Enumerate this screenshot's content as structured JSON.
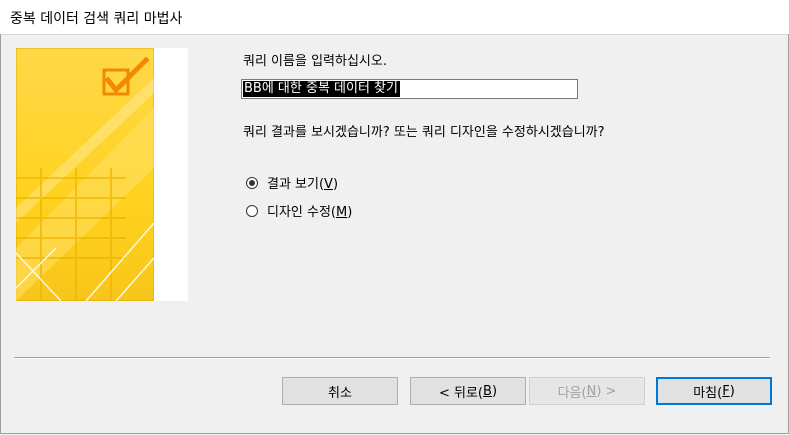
{
  "window": {
    "title": "중복 데이터 검색 쿼리 마법사"
  },
  "main": {
    "prompt_name": "쿼리 이름을 입력하십시오.",
    "query_name_value": "BB에 대한 중복 데이터 찾기",
    "prompt_action": "쿼리 결과를 보시겠습니까? 또는 쿼리 디자인을 수정하시겠습니까?",
    "options": [
      {
        "label": "결과 보기(",
        "mnemonic": "V",
        "suffix": ")",
        "selected": true
      },
      {
        "label": "디자인 수정(",
        "mnemonic": "M",
        "suffix": ")",
        "selected": false
      }
    ]
  },
  "buttons": {
    "cancel": "취소",
    "back": {
      "prefix": "< 뒤로(",
      "mnemonic": "B",
      "suffix": ")"
    },
    "next": {
      "prefix": "다음(",
      "mnemonic": "N",
      "suffix": ") >",
      "enabled": false
    },
    "finish": {
      "prefix": "마침(",
      "mnemonic": "F",
      "suffix": ")"
    }
  },
  "colors": {
    "art_yellow": "#ffd21e",
    "art_orange": "#f5a623",
    "focus_blue": "#0078d7"
  },
  "icons": {
    "wizard_art": "checkbox-table-graphic"
  }
}
